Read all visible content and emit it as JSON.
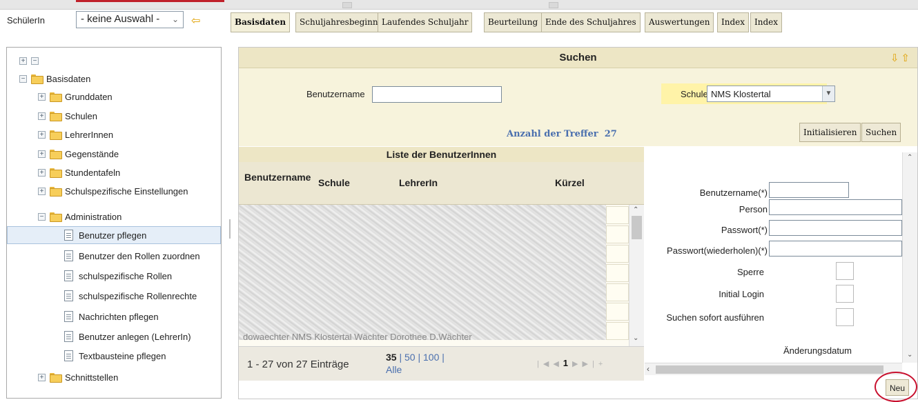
{
  "header": {
    "student_label": "SchülerIn",
    "student_select_value": "- keine Auswahl -"
  },
  "tabs": [
    "Basisdaten",
    "Schuljahresbeginn",
    "Laufendes Schuljahr",
    "Beurteilung",
    "Ende des Schuljahres",
    "Auswertungen",
    "Index",
    "Index"
  ],
  "tree": {
    "root": "Basisdaten",
    "items": [
      {
        "label": "Grunddaten"
      },
      {
        "label": "Schulen"
      },
      {
        "label": "LehrerInnen"
      },
      {
        "label": "Gegenstände"
      },
      {
        "label": "Stundentafeln"
      },
      {
        "label": "Schulspezifische Einstellungen"
      },
      {
        "label": "Administration"
      }
    ],
    "admin_children": [
      {
        "label": "Benutzer pflegen"
      },
      {
        "label": "Benutzer den Rollen zuordnen"
      },
      {
        "label": "schulspezifische Rollen"
      },
      {
        "label": "schulspezifische Rollenrechte"
      },
      {
        "label": "Nachrichten pflegen"
      },
      {
        "label": "Benutzer anlegen (LehrerIn)"
      },
      {
        "label": "Textbausteine pflegen"
      }
    ],
    "last": "Schnittstellen"
  },
  "search": {
    "title": "Suchen",
    "username_label": "Benutzername",
    "username_value": "",
    "school_label": "Schule",
    "school_value": "NMS Klostertal",
    "hits_label": "Anzahl der Treffer",
    "hits_count": "27",
    "btn_init": "Initialisieren",
    "btn_search": "Suchen"
  },
  "list": {
    "title": "Liste der BenutzerInnen",
    "columns": [
      "Benutzername",
      "Schule",
      "LehrerIn",
      "Kürzel"
    ],
    "partial_row": "dowaechter     NMS Klostertal  Wächter Dorothee           D.Wächter",
    "pager_info": "1 - 27 von 27 Einträge",
    "page_size_current": "35",
    "page_size_50": "50",
    "page_size_100": "100",
    "page_size_all": "Alle",
    "current_page": "1"
  },
  "form": {
    "username_label": "Benutzername(*)",
    "person_label": "Person",
    "password_label": "Passwort(*)",
    "password_repeat_label": "Passwort(wiederholen)(*)",
    "lock_label": "Sperre",
    "initial_login_label": "Initial Login",
    "search_now_label": "Suchen sofort ausführen",
    "changed_date_label": "Änderungsdatum"
  },
  "buttons": {
    "new": "Neu"
  }
}
